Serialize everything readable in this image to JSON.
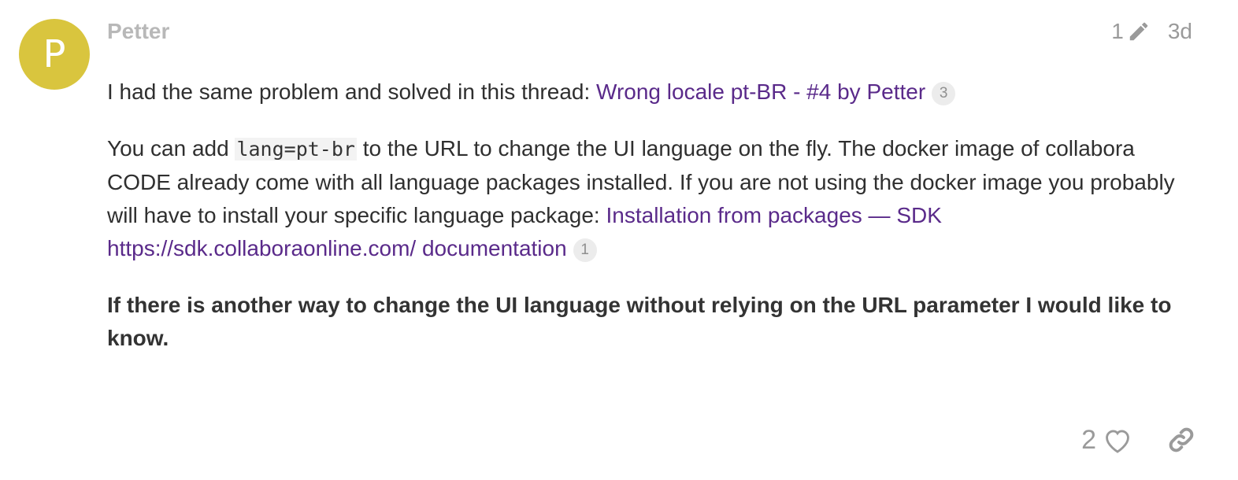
{
  "post": {
    "avatar_letter": "P",
    "avatar_color": "#d9c53e",
    "username": "Petter",
    "edit_count": "1",
    "date": "3d",
    "paragraph1": {
      "text": "I had the same problem and solved in this thread: ",
      "link_text": "Wrong locale pt-BR - #4 by Petter",
      "link_clicks": "3"
    },
    "paragraph2": {
      "text_before_code": "You can add ",
      "code": "lang=pt-br",
      "text_after_code": " to the URL to change the UI language on the fly. The docker image of collabora CODE already come with all language packages installed. If you are not using the docker image you probably will have to install your specific language package: ",
      "link_text": "Installation from packages — SDK https://sdk.collaboraonline.com/ documentation",
      "link_clicks": "1"
    },
    "paragraph3": "If there is another way to change the UI language without relying on the URL parameter I would like to know.",
    "like_count": "2",
    "link_color": "#5a2a8a",
    "icons": {
      "edit": "pencil-icon",
      "like": "heart-icon",
      "share": "link-icon"
    }
  }
}
